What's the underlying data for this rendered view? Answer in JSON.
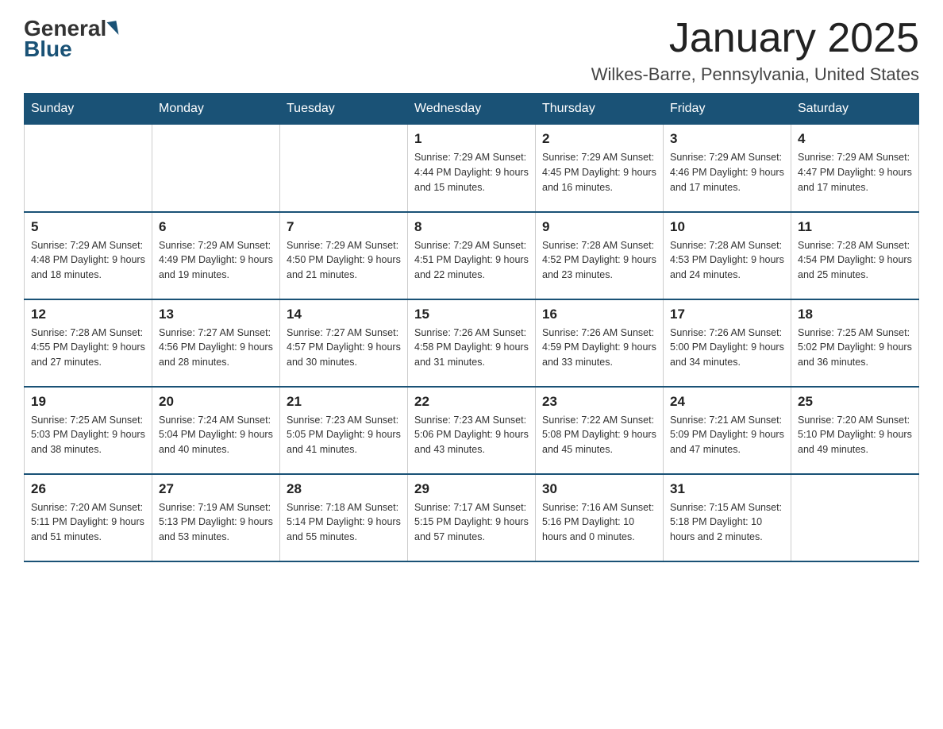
{
  "logo": {
    "general": "General",
    "blue": "Blue"
  },
  "header": {
    "title": "January 2025",
    "location": "Wilkes-Barre, Pennsylvania, United States"
  },
  "days_of_week": [
    "Sunday",
    "Monday",
    "Tuesday",
    "Wednesday",
    "Thursday",
    "Friday",
    "Saturday"
  ],
  "weeks": [
    [
      {
        "day": "",
        "info": ""
      },
      {
        "day": "",
        "info": ""
      },
      {
        "day": "",
        "info": ""
      },
      {
        "day": "1",
        "info": "Sunrise: 7:29 AM\nSunset: 4:44 PM\nDaylight: 9 hours\nand 15 minutes."
      },
      {
        "day": "2",
        "info": "Sunrise: 7:29 AM\nSunset: 4:45 PM\nDaylight: 9 hours\nand 16 minutes."
      },
      {
        "day": "3",
        "info": "Sunrise: 7:29 AM\nSunset: 4:46 PM\nDaylight: 9 hours\nand 17 minutes."
      },
      {
        "day": "4",
        "info": "Sunrise: 7:29 AM\nSunset: 4:47 PM\nDaylight: 9 hours\nand 17 minutes."
      }
    ],
    [
      {
        "day": "5",
        "info": "Sunrise: 7:29 AM\nSunset: 4:48 PM\nDaylight: 9 hours\nand 18 minutes."
      },
      {
        "day": "6",
        "info": "Sunrise: 7:29 AM\nSunset: 4:49 PM\nDaylight: 9 hours\nand 19 minutes."
      },
      {
        "day": "7",
        "info": "Sunrise: 7:29 AM\nSunset: 4:50 PM\nDaylight: 9 hours\nand 21 minutes."
      },
      {
        "day": "8",
        "info": "Sunrise: 7:29 AM\nSunset: 4:51 PM\nDaylight: 9 hours\nand 22 minutes."
      },
      {
        "day": "9",
        "info": "Sunrise: 7:28 AM\nSunset: 4:52 PM\nDaylight: 9 hours\nand 23 minutes."
      },
      {
        "day": "10",
        "info": "Sunrise: 7:28 AM\nSunset: 4:53 PM\nDaylight: 9 hours\nand 24 minutes."
      },
      {
        "day": "11",
        "info": "Sunrise: 7:28 AM\nSunset: 4:54 PM\nDaylight: 9 hours\nand 25 minutes."
      }
    ],
    [
      {
        "day": "12",
        "info": "Sunrise: 7:28 AM\nSunset: 4:55 PM\nDaylight: 9 hours\nand 27 minutes."
      },
      {
        "day": "13",
        "info": "Sunrise: 7:27 AM\nSunset: 4:56 PM\nDaylight: 9 hours\nand 28 minutes."
      },
      {
        "day": "14",
        "info": "Sunrise: 7:27 AM\nSunset: 4:57 PM\nDaylight: 9 hours\nand 30 minutes."
      },
      {
        "day": "15",
        "info": "Sunrise: 7:26 AM\nSunset: 4:58 PM\nDaylight: 9 hours\nand 31 minutes."
      },
      {
        "day": "16",
        "info": "Sunrise: 7:26 AM\nSunset: 4:59 PM\nDaylight: 9 hours\nand 33 minutes."
      },
      {
        "day": "17",
        "info": "Sunrise: 7:26 AM\nSunset: 5:00 PM\nDaylight: 9 hours\nand 34 minutes."
      },
      {
        "day": "18",
        "info": "Sunrise: 7:25 AM\nSunset: 5:02 PM\nDaylight: 9 hours\nand 36 minutes."
      }
    ],
    [
      {
        "day": "19",
        "info": "Sunrise: 7:25 AM\nSunset: 5:03 PM\nDaylight: 9 hours\nand 38 minutes."
      },
      {
        "day": "20",
        "info": "Sunrise: 7:24 AM\nSunset: 5:04 PM\nDaylight: 9 hours\nand 40 minutes."
      },
      {
        "day": "21",
        "info": "Sunrise: 7:23 AM\nSunset: 5:05 PM\nDaylight: 9 hours\nand 41 minutes."
      },
      {
        "day": "22",
        "info": "Sunrise: 7:23 AM\nSunset: 5:06 PM\nDaylight: 9 hours\nand 43 minutes."
      },
      {
        "day": "23",
        "info": "Sunrise: 7:22 AM\nSunset: 5:08 PM\nDaylight: 9 hours\nand 45 minutes."
      },
      {
        "day": "24",
        "info": "Sunrise: 7:21 AM\nSunset: 5:09 PM\nDaylight: 9 hours\nand 47 minutes."
      },
      {
        "day": "25",
        "info": "Sunrise: 7:20 AM\nSunset: 5:10 PM\nDaylight: 9 hours\nand 49 minutes."
      }
    ],
    [
      {
        "day": "26",
        "info": "Sunrise: 7:20 AM\nSunset: 5:11 PM\nDaylight: 9 hours\nand 51 minutes."
      },
      {
        "day": "27",
        "info": "Sunrise: 7:19 AM\nSunset: 5:13 PM\nDaylight: 9 hours\nand 53 minutes."
      },
      {
        "day": "28",
        "info": "Sunrise: 7:18 AM\nSunset: 5:14 PM\nDaylight: 9 hours\nand 55 minutes."
      },
      {
        "day": "29",
        "info": "Sunrise: 7:17 AM\nSunset: 5:15 PM\nDaylight: 9 hours\nand 57 minutes."
      },
      {
        "day": "30",
        "info": "Sunrise: 7:16 AM\nSunset: 5:16 PM\nDaylight: 10 hours\nand 0 minutes."
      },
      {
        "day": "31",
        "info": "Sunrise: 7:15 AM\nSunset: 5:18 PM\nDaylight: 10 hours\nand 2 minutes."
      },
      {
        "day": "",
        "info": ""
      }
    ]
  ]
}
